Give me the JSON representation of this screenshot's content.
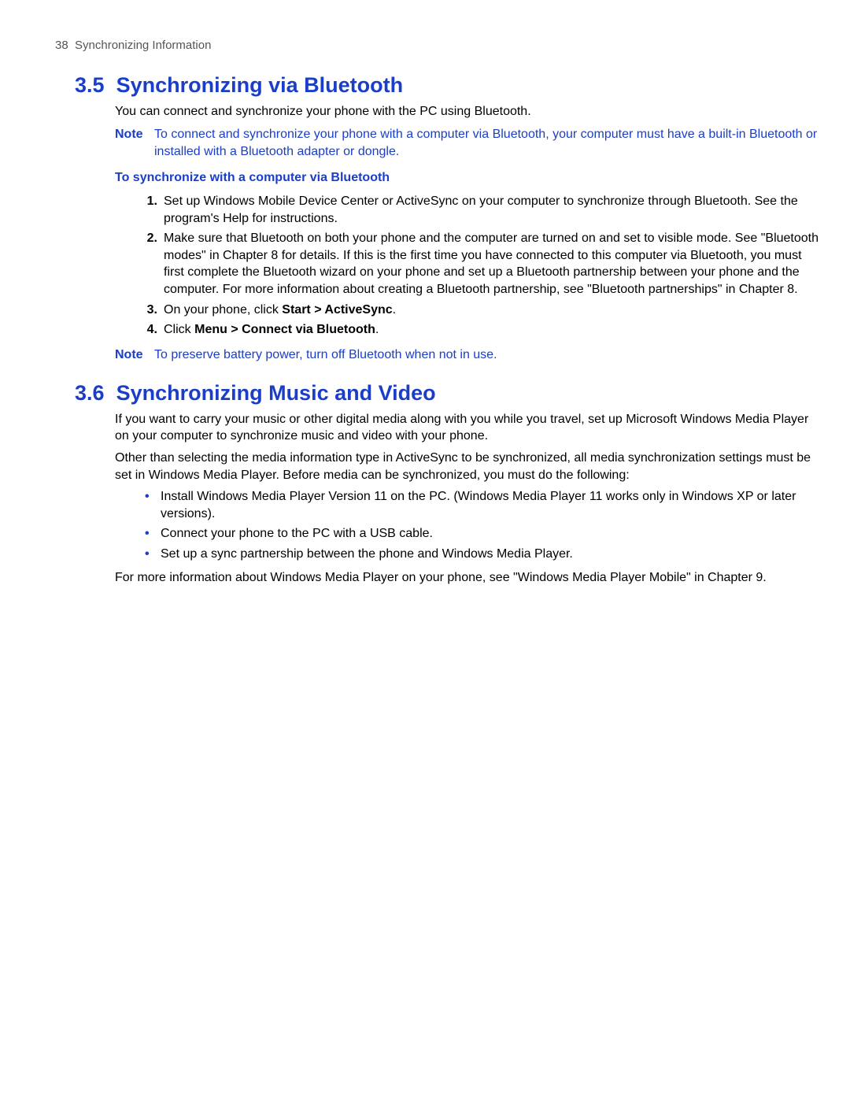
{
  "header": {
    "page_number": "38",
    "chapter_title": "Synchronizing Information"
  },
  "section35": {
    "number": "3.5",
    "title": "Synchronizing via Bluetooth",
    "intro": "You can connect and synchronize your phone with the PC using Bluetooth.",
    "note_label": "Note",
    "note_text": "To connect and synchronize your phone with a computer via Bluetooth, your computer must have a built-in Bluetooth or installed with a Bluetooth adapter or dongle.",
    "subhead": "To synchronize with a computer via Bluetooth",
    "steps": [
      {
        "num": "1.",
        "text": "Set up Windows Mobile Device Center or ActiveSync on your computer to synchronize through Bluetooth. See the program's Help for instructions."
      },
      {
        "num": "2.",
        "text": "Make sure that Bluetooth on both your phone and the computer are turned on and set to visible mode. See \"Bluetooth modes\" in Chapter 8 for details. If this is the first time you have connected to this computer via Bluetooth, you must first complete the Bluetooth wizard on your phone and set up a Bluetooth partnership between your phone and the computer. For more information about creating a Bluetooth partnership, see \"Bluetooth partnerships\" in Chapter 8."
      }
    ],
    "step3": {
      "num": "3.",
      "prefix": "On your phone, click ",
      "bold": "Start > ActiveSync",
      "suffix": "."
    },
    "step4": {
      "num": "4.",
      "prefix": "Click ",
      "bold": "Menu > Connect via Bluetooth",
      "suffix": "."
    },
    "note2_label": "Note",
    "note2_text": "To preserve battery power, turn off Bluetooth when not in use."
  },
  "section36": {
    "number": "3.6",
    "title": "Synchronizing Music and Video",
    "para1": "If you want to carry your music or other digital media along with you while you travel, set up Microsoft Windows Media Player on your computer to synchronize music and video with your phone.",
    "para2": "Other than selecting the media information type in ActiveSync to be synchronized, all media synchronization settings must be set in Windows Media Player. Before media can be synchronized, you must do the following:",
    "bullets": [
      "Install Windows Media Player Version 11 on the PC. (Windows Media Player 11 works only in Windows XP or later versions).",
      "Connect your phone to the PC with a USB cable.",
      "Set up a sync partnership between the phone and Windows Media Player."
    ],
    "para3": "For more information about Windows Media Player on your phone, see \"Windows Media Player Mobile\" in Chapter 9."
  }
}
